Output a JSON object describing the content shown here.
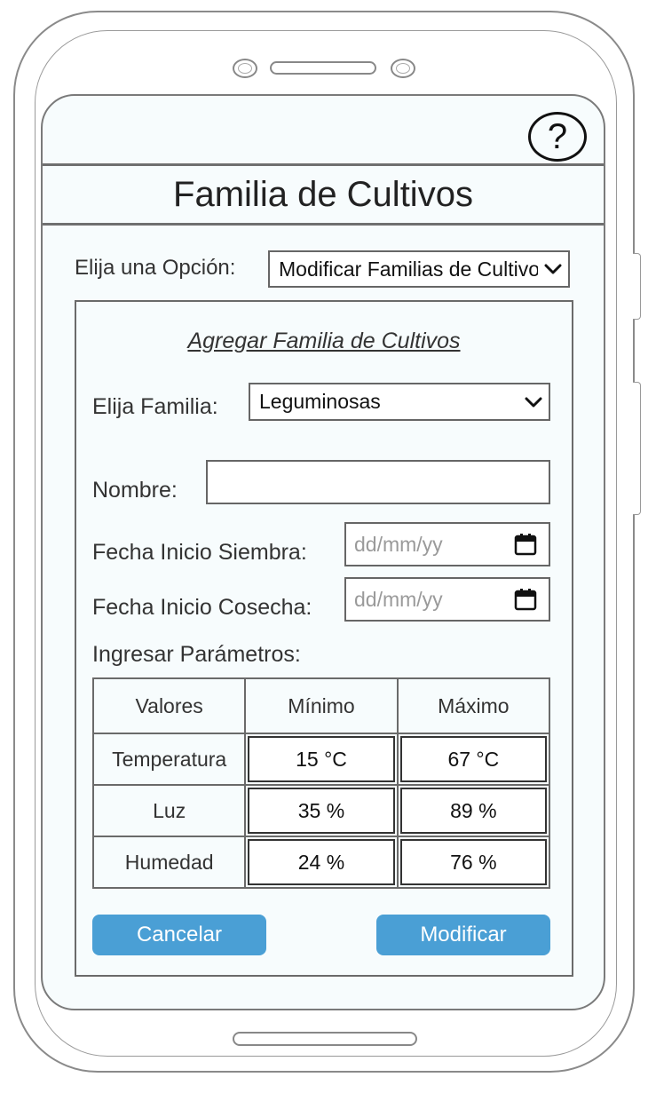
{
  "help": {
    "icon": "question-mark-icon",
    "glyph": "?"
  },
  "header": {
    "title": "Familia de Cultivos"
  },
  "option": {
    "label": "Elija una Opción:",
    "selected": "Modificar Familias de Cultivos"
  },
  "form": {
    "title": "Agregar Familia de Cultivos",
    "family_label": "Elija Familia:",
    "family_selected": "Leguminosas",
    "name_label": "Nombre:",
    "name_value": "",
    "sow_label": "Fecha Inicio Siembra:",
    "sow_placeholder": "dd/mm/yy",
    "harvest_label": "Fecha Inicio Cosecha:",
    "harvest_placeholder": "dd/mm/yy",
    "params_label": "Ingresar Parámetros:"
  },
  "table": {
    "headers": [
      "Valores",
      "Mínimo",
      "Máximo"
    ],
    "rows": [
      {
        "name": "Temperatura",
        "min": "15 °C",
        "max": "67 °C"
      },
      {
        "name": "Luz",
        "min": "35 %",
        "max": "89 %"
      },
      {
        "name": "Humedad",
        "min": "24 %",
        "max": "76 %"
      }
    ]
  },
  "buttons": {
    "cancel": "Cancelar",
    "modify": "Modificar"
  },
  "colors": {
    "accent": "#4a9fd5",
    "screen_bg": "#f7fcfd",
    "border": "#6a6a6a"
  }
}
